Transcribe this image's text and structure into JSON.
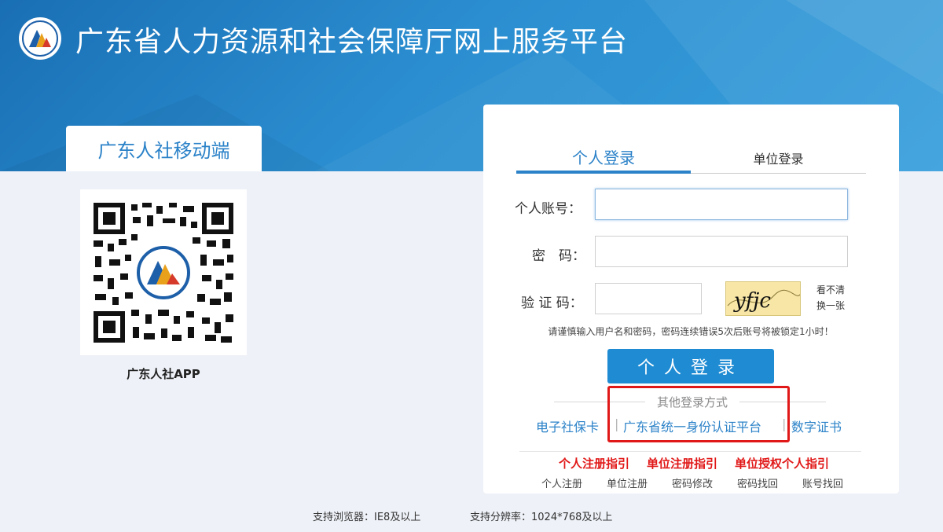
{
  "header": {
    "title": "广东省人力资源和社会保障厅网上服务平台",
    "logo_icon": "hrss-logo-icon"
  },
  "mobile": {
    "tab_label": "广东人社移动端",
    "qr_icon": "qr-code-icon",
    "app_label": "广东人社APP"
  },
  "login": {
    "tabs": [
      {
        "label": "个人登录",
        "active": true
      },
      {
        "label": "单位登录",
        "active": false
      }
    ],
    "account_label": "个人账号：",
    "account_value": "",
    "password_label": "密　码：",
    "password_value": "",
    "captcha_label": "验 证 码：",
    "captcha_value": "",
    "captcha_text": "yfjc",
    "refresh_line1": "看不清",
    "refresh_line2": "换一张",
    "warning": "请谨慎输入用户名和密码，密码连续错误5次后账号将被锁定1小时！",
    "submit_label": "个人登录",
    "other_title": "其他登录方式",
    "alt_methods": [
      "电子社保卡",
      "广东省统一身份认证平台",
      "数字证书"
    ],
    "separator": "|",
    "guides": [
      "个人注册指引",
      "单位注册指引",
      "单位授权个人指引"
    ],
    "links": [
      "个人注册",
      "单位注册",
      "密码修改",
      "密码找回",
      "账号找回"
    ]
  },
  "footer": {
    "browser": "支持浏览器：IE8及以上",
    "resolution": "支持分辨率：1024*768及以上"
  },
  "colors": {
    "accent": "#2b82c8",
    "button": "#1e8bd3",
    "guide_red": "#e11818",
    "banner": "#2b8ed0"
  }
}
